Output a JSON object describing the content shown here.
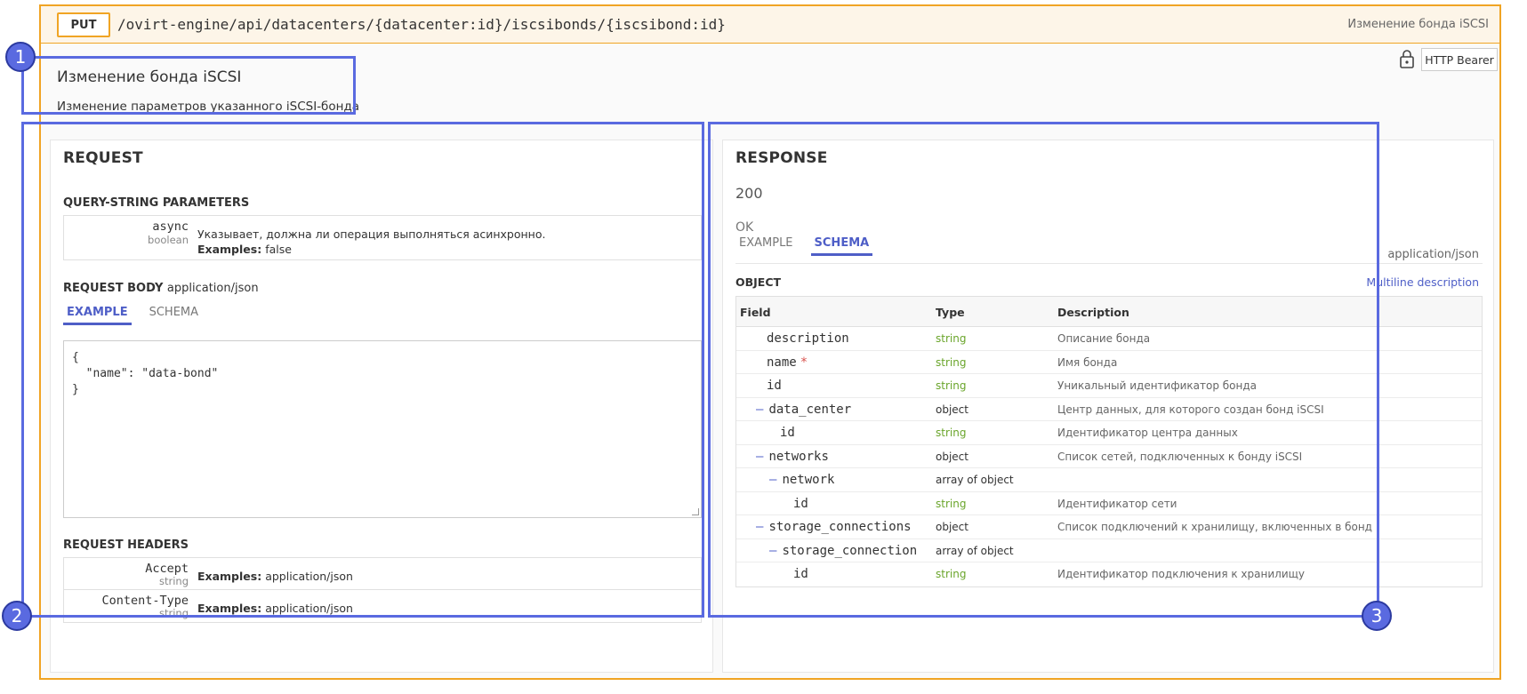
{
  "operation": {
    "method": "PUT",
    "path": "/ovirt-engine/api/datacenters/{datacenter:id}/iscsibonds/{iscsibond:id}",
    "summary": "Изменение бонда iSCSI",
    "auth_label": "HTTP Bearer",
    "title": "Изменение бонда iSCSI",
    "description": "Изменение параметров указанного iSCSI-бонда"
  },
  "request": {
    "heading": "REQUEST",
    "query_heading": "QUERY-STRING PARAMETERS",
    "query_params": [
      {
        "name": "async",
        "type": "boolean",
        "description": "Указывает, должна ли операция выполняться асинхронно.",
        "examples_label": "Examples:",
        "example": "false"
      }
    ],
    "body_heading": "REQUEST BODY",
    "body_content_type": "application/json",
    "body_tabs": [
      "EXAMPLE",
      "SCHEMA"
    ],
    "example_json": "{\n  \"name\": \"data-bond\"\n}",
    "headers_heading": "REQUEST HEADERS",
    "headers": [
      {
        "name": "Accept",
        "type": "string",
        "examples_label": "Examples:",
        "example": "application/json"
      },
      {
        "name": "Content-Type",
        "type": "string",
        "examples_label": "Examples:",
        "example": "application/json"
      }
    ]
  },
  "response": {
    "heading": "RESPONSE",
    "code": "200",
    "status": "OK",
    "tabs": [
      "EXAMPLE",
      "SCHEMA"
    ],
    "content_type": "application/json",
    "object_label": "OBJECT",
    "multiline_link": "Multiline description",
    "columns": [
      "Field",
      "Type",
      "Description"
    ],
    "fields": [
      {
        "name": "description",
        "type": "string",
        "description": "Описание бонда",
        "depth": 0,
        "expandable": false,
        "required": false
      },
      {
        "name": "name",
        "type": "string",
        "description": "Имя бонда",
        "depth": 0,
        "expandable": false,
        "required": true
      },
      {
        "name": "id",
        "type": "string",
        "description": "Уникальный идентификатор бонда",
        "depth": 0,
        "expandable": false,
        "required": false
      },
      {
        "name": "data_center",
        "type": "object",
        "description": "Центр данных, для которого создан бонд iSCSI",
        "depth": 0,
        "expandable": true,
        "required": false
      },
      {
        "name": "id",
        "type": "string",
        "description": "Идентификатор центра данных",
        "depth": 1,
        "expandable": false,
        "required": false
      },
      {
        "name": "networks",
        "type": "object",
        "description": "Список сетей, подключенных к бонду iSCSI",
        "depth": 0,
        "expandable": true,
        "required": false
      },
      {
        "name": "network",
        "type": "array of object",
        "description": "",
        "depth": 1,
        "expandable": true,
        "required": false
      },
      {
        "name": "id",
        "type": "string",
        "description": "Идентификатор сети",
        "depth": 2,
        "expandable": false,
        "required": false
      },
      {
        "name": "storage_connections",
        "type": "object",
        "description": "Список подключений к хранилищу, включенных в бонд",
        "depth": 0,
        "expandable": true,
        "required": false
      },
      {
        "name": "storage_connection",
        "type": "array of object",
        "description": "",
        "depth": 1,
        "expandable": true,
        "required": false
      },
      {
        "name": "id",
        "type": "string",
        "description": "Идентификатор подключения к хранилищу",
        "depth": 2,
        "expandable": false,
        "required": false
      }
    ]
  },
  "annotations": [
    "1",
    "2",
    "3"
  ],
  "colors": {
    "accent": "#4e5ec7",
    "method_border": "#f0a424",
    "annotation": "#5a6ae0",
    "string_type": "#6aa52b"
  }
}
